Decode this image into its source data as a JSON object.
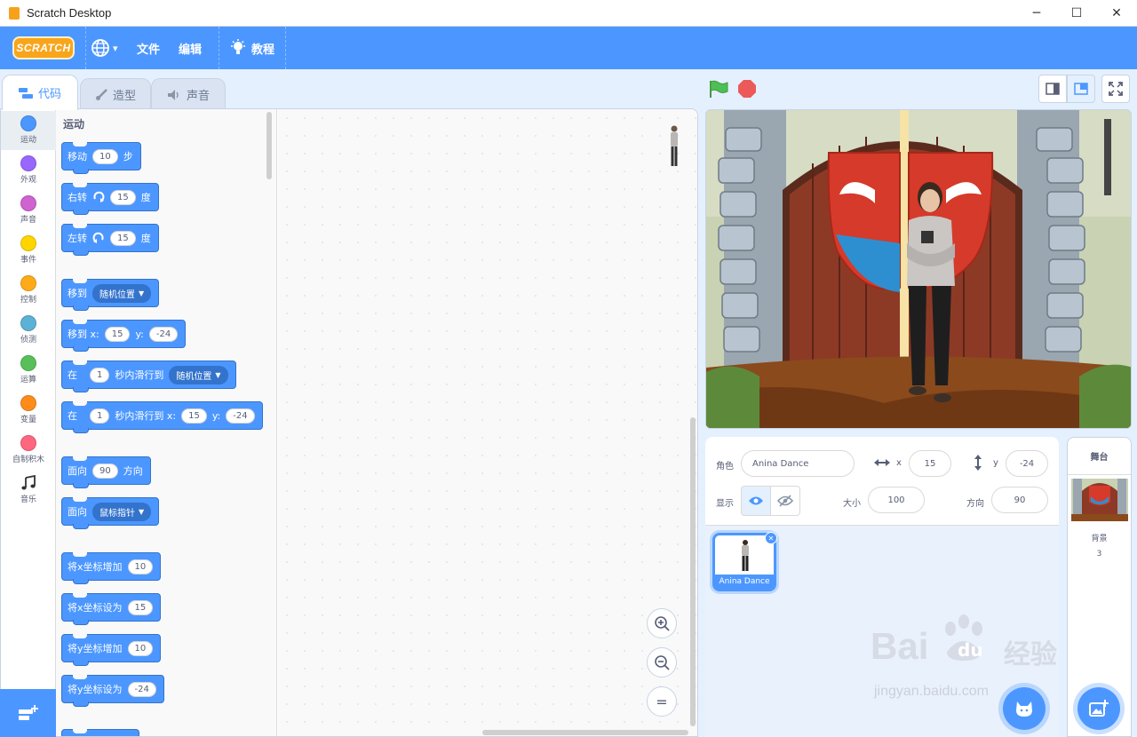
{
  "window": {
    "title": "Scratch Desktop",
    "minimize": "─",
    "maximize": "☐",
    "close": "✕"
  },
  "menubar": {
    "logo": "SCRATCH",
    "language_caret": "▾",
    "file": "文件",
    "edit": "编辑",
    "tutorials": "教程"
  },
  "tabs": {
    "code": "代码",
    "costumes": "造型",
    "sounds": "声音"
  },
  "categories": [
    {
      "label": "运动",
      "color": "#4c97ff"
    },
    {
      "label": "外观",
      "color": "#9966ff"
    },
    {
      "label": "声音",
      "color": "#cf63cf"
    },
    {
      "label": "事件",
      "color": "#ffd500"
    },
    {
      "label": "控制",
      "color": "#ffab19"
    },
    {
      "label": "侦测",
      "color": "#5cb1d6"
    },
    {
      "label": "运算",
      "color": "#59c059"
    },
    {
      "label": "变量",
      "color": "#ff8c1a"
    },
    {
      "label": "自制积木",
      "color": "#ff6680"
    },
    {
      "label": "音乐",
      "color": ""
    }
  ],
  "palette": {
    "title": "运动",
    "blocks": {
      "move": {
        "a": "移动",
        "n": "10",
        "b": "步"
      },
      "turn_right": {
        "a": "右转",
        "n": "15",
        "b": "度"
      },
      "turn_left": {
        "a": "左转",
        "n": "15",
        "b": "度"
      },
      "goto": {
        "a": "移到",
        "d": "随机位置"
      },
      "goto_xy": {
        "a": "移到 x:",
        "x": "15",
        "y_label": "y:",
        "y": "-24"
      },
      "glide": {
        "a": "在",
        "n": "1",
        "b": "秒内滑行到",
        "d": "随机位置"
      },
      "glide_xy": {
        "a": "在",
        "n": "1",
        "b": "秒内滑行到 x:",
        "x": "15",
        "y_label": "y:",
        "y": "-24"
      },
      "point_dir": {
        "a": "面向",
        "n": "90",
        "b": "方向"
      },
      "point_towards": {
        "a": "面向",
        "d": "鼠标指针"
      },
      "change_x": {
        "a": "将x坐标增加",
        "n": "10"
      },
      "set_x": {
        "a": "将x坐标设为",
        "n": "15"
      },
      "change_y": {
        "a": "将y坐标增加",
        "n": "10"
      },
      "set_y": {
        "a": "将y坐标设为",
        "n": "-24"
      }
    }
  },
  "zoom": {
    "in": "+",
    "out": "−",
    "reset": "="
  },
  "sprite_info": {
    "sprite_label": "角色",
    "sprite_name": "Anina Dance",
    "x_label": "x",
    "x": "15",
    "y_label": "y",
    "y": "-24",
    "show_label": "显示",
    "size_label": "大小",
    "size": "100",
    "direction_label": "方向",
    "direction": "90"
  },
  "sprites": [
    {
      "name": "Anina Dance"
    }
  ],
  "stage_pane": {
    "title": "舞台",
    "backdrops_label": "背景",
    "backdrop_count": "3"
  },
  "watermark": {
    "brand": "Bai",
    "brand_du": "du",
    "cn": "经验",
    "url": "jingyan.baidu.com"
  }
}
